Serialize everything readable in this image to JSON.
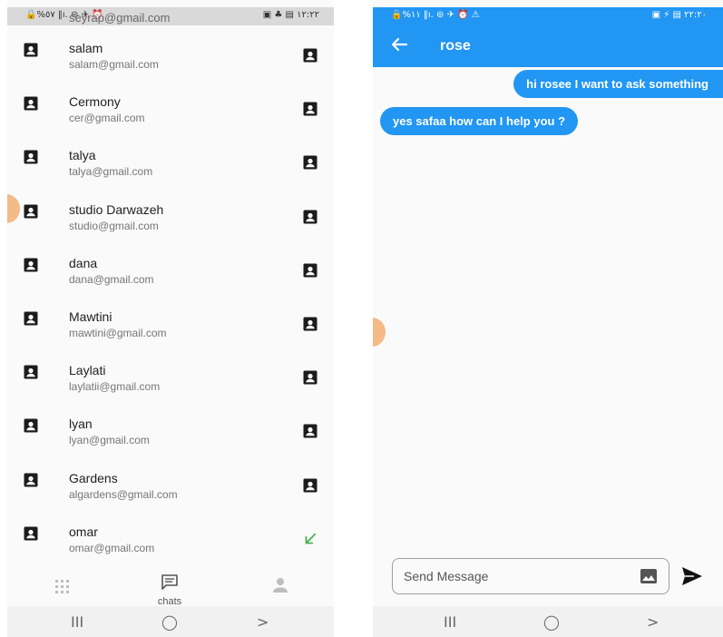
{
  "contacts_screen": {
    "status_bar": {
      "left": "🔒%٥٧ ‖ı. ⊜ ✈ ⏰",
      "right": "▣ ♣ ▤ ١٢:٢٢"
    },
    "clipped_top_email": "seyrap@gmail.com",
    "contacts": [
      {
        "name": "salam",
        "email": "salam@gmail.com",
        "trailing_icon": "contact-icon"
      },
      {
        "name": "Cermony",
        "email": "cer@gmail.com",
        "trailing_icon": "contact-icon"
      },
      {
        "name": "talya",
        "email": "talya@gmail.com",
        "trailing_icon": "contact-icon"
      },
      {
        "name": "studio Darwazeh",
        "email": "studio@gmail.com",
        "trailing_icon": "contact-icon"
      },
      {
        "name": "dana",
        "email": "dana@gmail.com",
        "trailing_icon": "contact-icon"
      },
      {
        "name": "Mawtini",
        "email": "mawtini@gmail.com",
        "trailing_icon": "contact-icon"
      },
      {
        "name": "Laylati",
        "email": "laylatii@gmail.com",
        "trailing_icon": "contact-icon"
      },
      {
        "name": "lyan",
        "email": "lyan@gmail.com",
        "trailing_icon": "contact-icon"
      },
      {
        "name": "Gardens",
        "email": "algardens@gmail.com",
        "trailing_icon": "contact-icon"
      },
      {
        "name": "omar",
        "email": "omar@gmail.com",
        "trailing_icon": "arrow-down-left-icon"
      }
    ],
    "bottom_nav": {
      "chats_label": "chats"
    },
    "system_nav": {
      "recents": "III",
      "home": "◯",
      "back": ">"
    }
  },
  "chat_screen": {
    "status_bar": {
      "left": "🔒%١١ ‖ı. ⊜ ✈ ⏰ ⚠",
      "right": "▣ ⚡ ▤ ٢٢:٢٠"
    },
    "title": "rose",
    "messages": [
      {
        "text": "hi rosee I want to ask something",
        "direction": "sent"
      },
      {
        "text": "yes safaa how can I help you ?",
        "direction": "received"
      }
    ],
    "input": {
      "value": "",
      "placeholder": "Send Message"
    },
    "system_nav": {
      "recents": "III",
      "home": "◯",
      "back": ">"
    }
  },
  "colors": {
    "primary": "#2196f3",
    "accept_green": "#4caf50",
    "peek_dot": "#f3b27a"
  }
}
